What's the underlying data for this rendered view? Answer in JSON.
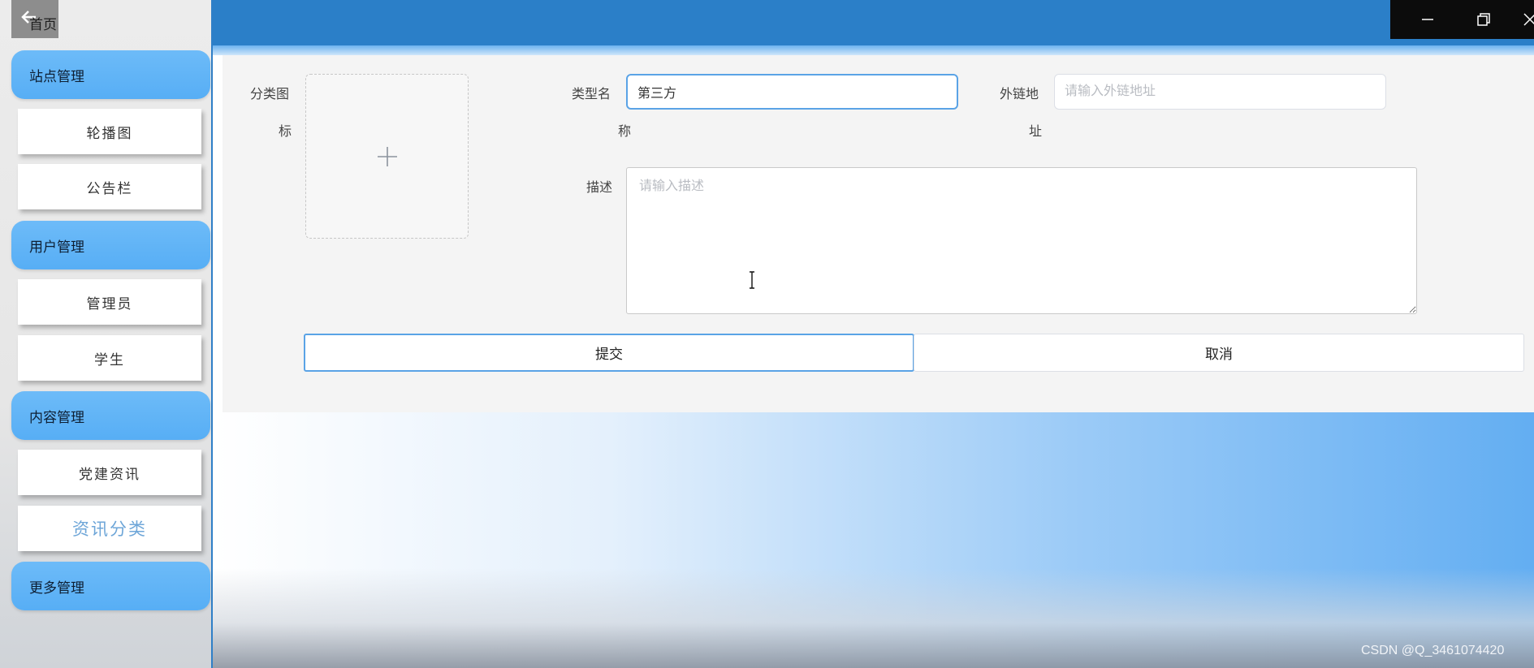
{
  "sidebar": {
    "home_label": "首页",
    "sections": [
      {
        "label": "站点管理",
        "items": [
          {
            "label": "轮播图"
          },
          {
            "label": "公告栏"
          }
        ]
      },
      {
        "label": "用户管理",
        "items": [
          {
            "label": "管理员"
          },
          {
            "label": "学生"
          }
        ]
      },
      {
        "label": "内容管理",
        "items": [
          {
            "label": "党建资讯"
          },
          {
            "label": "资讯分类",
            "active": true
          }
        ]
      },
      {
        "label": "更多管理",
        "items": []
      }
    ]
  },
  "window_controls": {
    "icons": [
      "minimize-icon",
      "restore-icon",
      "close-icon"
    ]
  },
  "form": {
    "icon_label_line1": "分类图",
    "icon_label_line2": "标",
    "type_name_label_line1": "类型名",
    "type_name_label_line2": "称",
    "type_name_value": "第三方",
    "link_label_line1": "外链地",
    "link_label_line2": "址",
    "link_placeholder": "请输入外链地址",
    "description_label": "描述",
    "description_placeholder": "请输入描述",
    "submit_label": "提交",
    "cancel_label": "取消"
  },
  "watermark": "CSDN @Q_3461074420",
  "colors": {
    "accent": "#2b7fc8",
    "section_header": "#5fb3f6",
    "active_item": "#6ea6d8"
  }
}
